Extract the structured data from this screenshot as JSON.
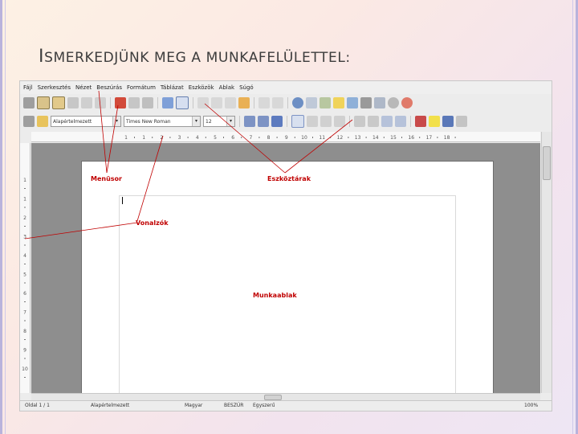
{
  "slide": {
    "title_first_letter": "I",
    "title_rest": "SMERKEDJÜNK MEG A MUNKAFELÜLETTEL",
    "title_colon": ":"
  },
  "menu": [
    "Fájl",
    "Szerkesztés",
    "Nézet",
    "Beszúrás",
    "Formátum",
    "Táblázat",
    "Eszközök",
    "Ablak",
    "Súgó"
  ],
  "toolbar": {
    "style_value": "Alapértelmezett",
    "font_value": "Times New Roman",
    "size_value": "12"
  },
  "ruler": {
    "h_ticks": [
      "1",
      "1",
      "2",
      "3",
      "4",
      "5",
      "6",
      "7",
      "8",
      "9",
      "10",
      "11",
      "12",
      "13",
      "14",
      "15",
      "16",
      "17",
      "18"
    ],
    "v_ticks": [
      "1",
      "1",
      "2",
      "3",
      "4",
      "5",
      "6",
      "7",
      "8",
      "9",
      "10"
    ]
  },
  "callouts": {
    "menusor": "Menüsor",
    "eszkoztarak": "Eszköztárak",
    "vonalzok": "Vonalzók",
    "munkaablak": "Munkaablak"
  },
  "status": {
    "page": "Oldal 1 / 1",
    "style": "Alapértelmezett",
    "language": "Magyar",
    "insert": "BESZÚR",
    "selection": "Egyszerű",
    "zoom": "100%"
  },
  "colors": {
    "callout": "#c00000"
  }
}
